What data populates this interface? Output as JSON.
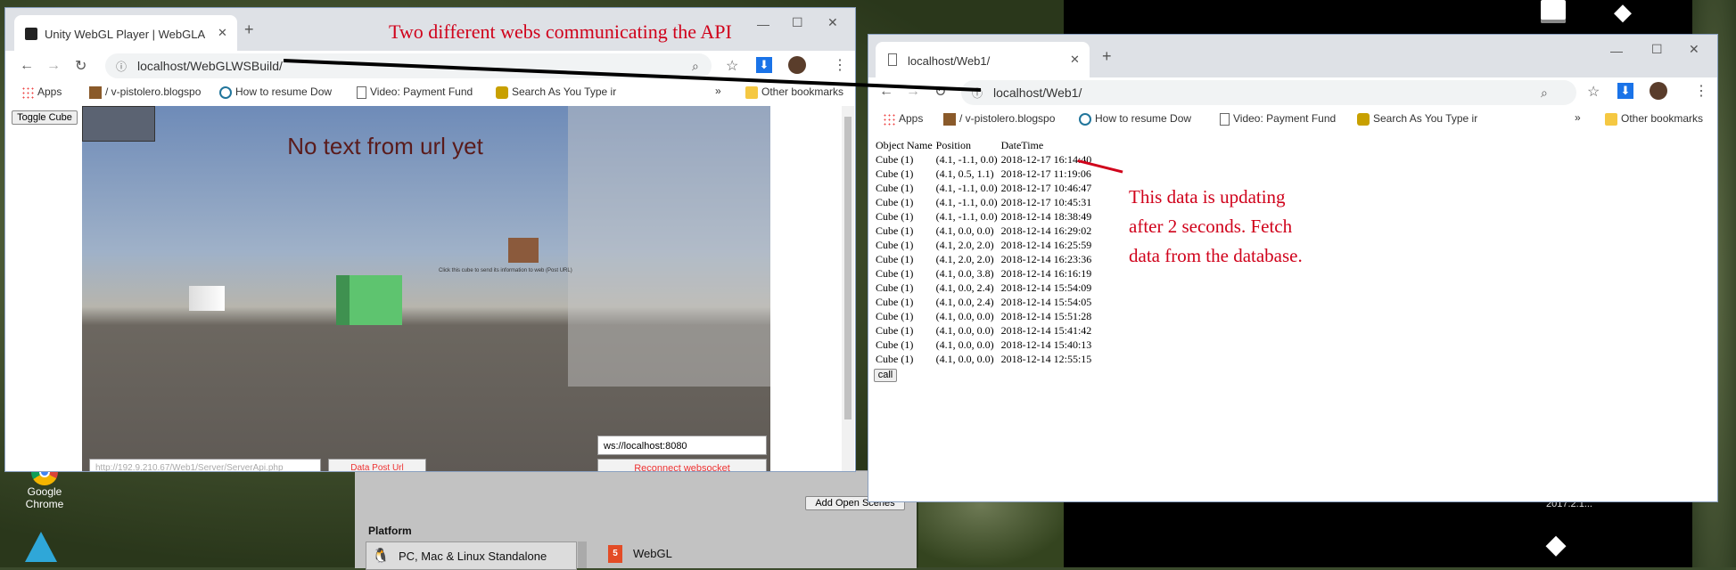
{
  "annotation_top": "Two different webs communicating the API",
  "annotation_right": [
    "This data is updating",
    "after 2 seconds. Fetch",
    "data from the database."
  ],
  "desktop": {
    "chrome_label_1": "Google",
    "chrome_label_2": "Chrome",
    "version_label": "2017.2.1..."
  },
  "window_left": {
    "tab_title": "Unity WebGL Player | WebGLAnd",
    "url": "localhost/WebGLWSBuild/",
    "bookmarks": [
      "Apps",
      "/ v-pistolero.blogspo",
      "How to resume Dow",
      "Video: Payment Fund",
      "Search As You Type ir",
      "Other bookmarks"
    ],
    "toggle_button": "Toggle Cube",
    "scene_text": "No text from url yet",
    "cube_hint": "Click this cube to send its information to web (Post URL)",
    "ws_input": "ws://localhost:8080",
    "url_input_placeholder": "http://192.9.210.67/Web1/Server/ServerApi.php",
    "data_post_button": "Data Post Url",
    "reconnect_button": "Reconnect websocket"
  },
  "window_right": {
    "tab_title": "localhost/Web1/",
    "url": "localhost/Web1/",
    "bookmarks": [
      "Apps",
      "/ v-pistolero.blogspo",
      "How to resume Dow",
      "Video: Payment Fund",
      "Search As You Type ir",
      "Other bookmarks"
    ],
    "headers": [
      "Object Name",
      "Position",
      "DateTime"
    ],
    "rows": [
      [
        "Cube (1)",
        "(4.1, -1.1, 0.0)",
        "2018-12-17 16:14:40"
      ],
      [
        "Cube (1)",
        "(4.1, 0.5, 1.1)",
        "2018-12-17 11:19:06"
      ],
      [
        "Cube (1)",
        "(4.1, -1.1, 0.0)",
        "2018-12-17 10:46:47"
      ],
      [
        "Cube (1)",
        "(4.1, -1.1, 0.0)",
        "2018-12-17 10:45:31"
      ],
      [
        "Cube (1)",
        "(4.1, -1.1, 0.0)",
        "2018-12-14 18:38:49"
      ],
      [
        "Cube (1)",
        "(4.1, 0.0, 0.0)",
        "2018-12-14 16:29:02"
      ],
      [
        "Cube (1)",
        "(4.1, 2.0, 2.0)",
        "2018-12-14 16:25:59"
      ],
      [
        "Cube (1)",
        "(4.1, 2.0, 2.0)",
        "2018-12-14 16:23:36"
      ],
      [
        "Cube (1)",
        "(4.1, 0.0, 3.8)",
        "2018-12-14 16:16:19"
      ],
      [
        "Cube (1)",
        "(4.1, 0.0, 2.4)",
        "2018-12-14 15:54:09"
      ],
      [
        "Cube (1)",
        "(4.1, 0.0, 2.4)",
        "2018-12-14 15:54:05"
      ],
      [
        "Cube (1)",
        "(4.1, 0.0, 0.0)",
        "2018-12-14 15:51:28"
      ],
      [
        "Cube (1)",
        "(4.1, 0.0, 0.0)",
        "2018-12-14 15:41:42"
      ],
      [
        "Cube (1)",
        "(4.1, 0.0, 0.0)",
        "2018-12-14 15:40:13"
      ],
      [
        "Cube (1)",
        "(4.1, 0.0, 0.0)",
        "2018-12-14 12:55:15"
      ]
    ],
    "call_button": "call"
  },
  "unity_editor": {
    "add_open_scenes": "Add Open Scenes",
    "platform_heading": "Platform",
    "platform_1": "PC, Mac & Linux Standalone",
    "platform_2": "WebGL"
  },
  "colors": {
    "annotation": "#d0021b",
    "chrome_blue": "#1a73e8"
  }
}
